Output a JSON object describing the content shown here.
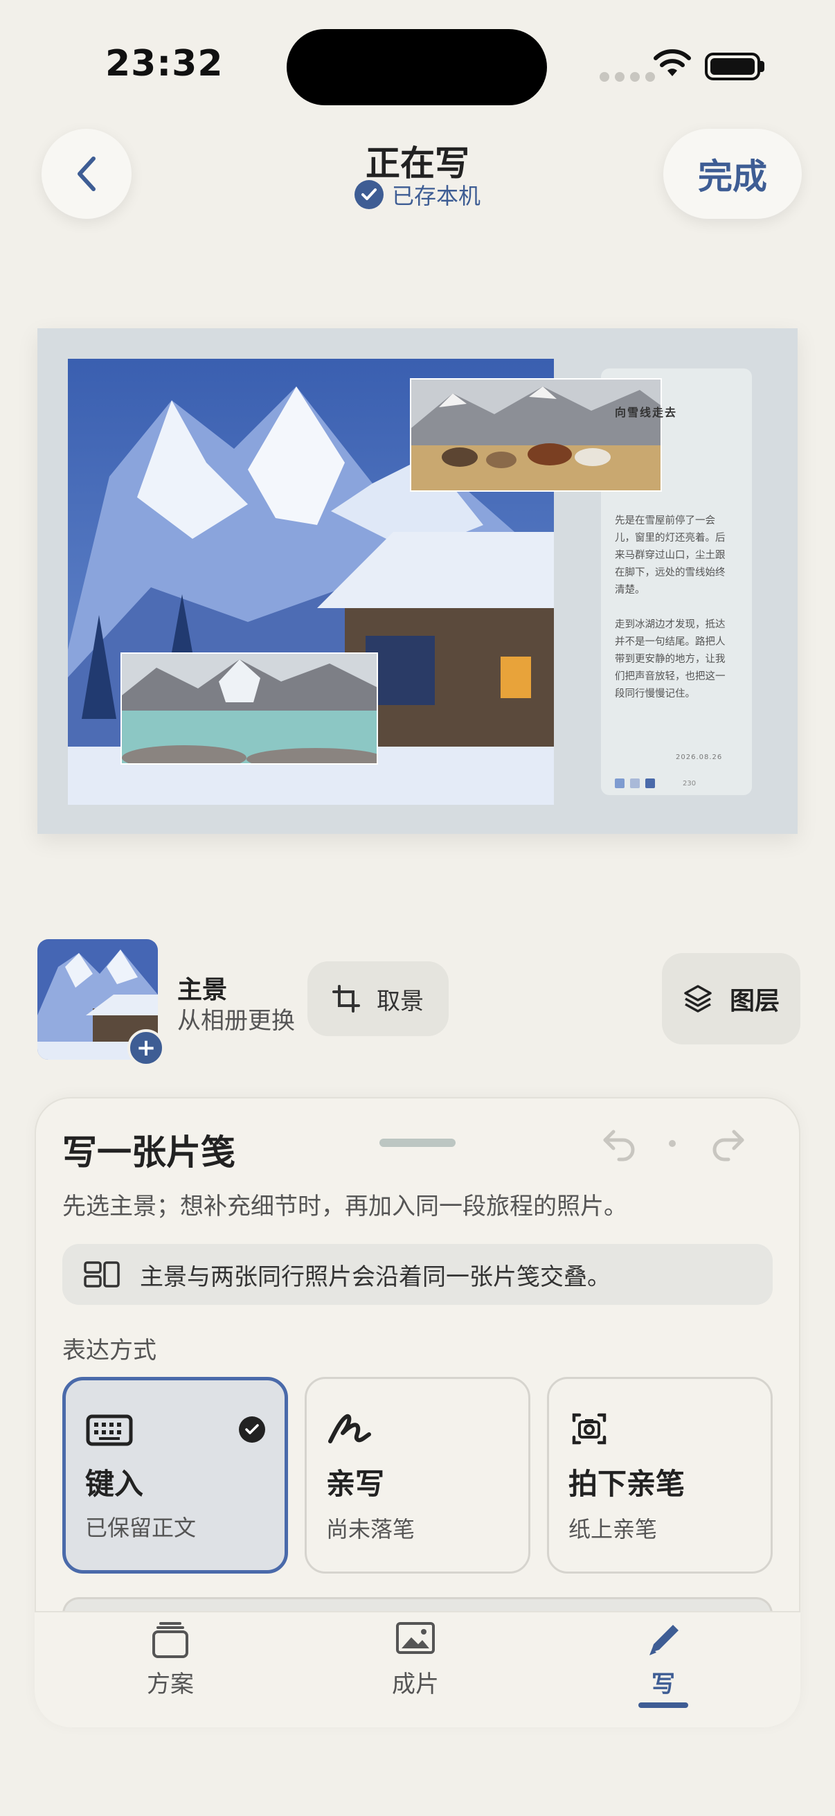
{
  "status_bar": {
    "time": "23:32"
  },
  "header": {
    "title": "正在写",
    "save_status": "已存本机",
    "done_label": "完成"
  },
  "postcard": {
    "card_title": "向雪线走去",
    "card_body": "先是在雪屋前停了一会儿，窗里的灯还亮着。后来马群穿过山口，尘土跟在脚下，远处的雪线始终清楚。\n\n走到冰湖边才发现，抵达并不是一句结尾。路把人带到更安静的地方，让我们把声音放轻，也把这一段同行慢慢记住。",
    "date": "2026.08.26",
    "page": "230",
    "dot_colors": [
      "#7e9bd0",
      "#a9b9d8",
      "#4a6aaa"
    ]
  },
  "controls": {
    "main_label": "主景",
    "main_sub": "从相册更换",
    "crop_label": "取景",
    "layers_label": "图层"
  },
  "sheet": {
    "title": "写一张片笺",
    "hint": "先选主景；想补充细节时，再加入同一段旅程的照片。",
    "info": "主景与两张同行照片会沿着同一张片笺交叠。",
    "section_label": "表达方式",
    "options": [
      {
        "title": "键入",
        "sub": "已保留正文",
        "icon": "keyboard-icon",
        "selected": true
      },
      {
        "title": "亲写",
        "sub": "尚未落笔",
        "icon": "handwriting-icon",
        "selected": false
      },
      {
        "title": "拍下亲笔",
        "sub": "纸上亲笔",
        "icon": "camera-icon",
        "selected": false
      }
    ]
  },
  "tabs": [
    {
      "label": "方案",
      "icon": "stack-icon"
    },
    {
      "label": "成片",
      "icon": "photo-icon"
    },
    {
      "label": "写",
      "icon": "pen-icon",
      "active": true
    }
  ],
  "colors": {
    "accent": "#3e5d94",
    "background": "#f2f0ea",
    "sheet": "#f4f2ec"
  }
}
